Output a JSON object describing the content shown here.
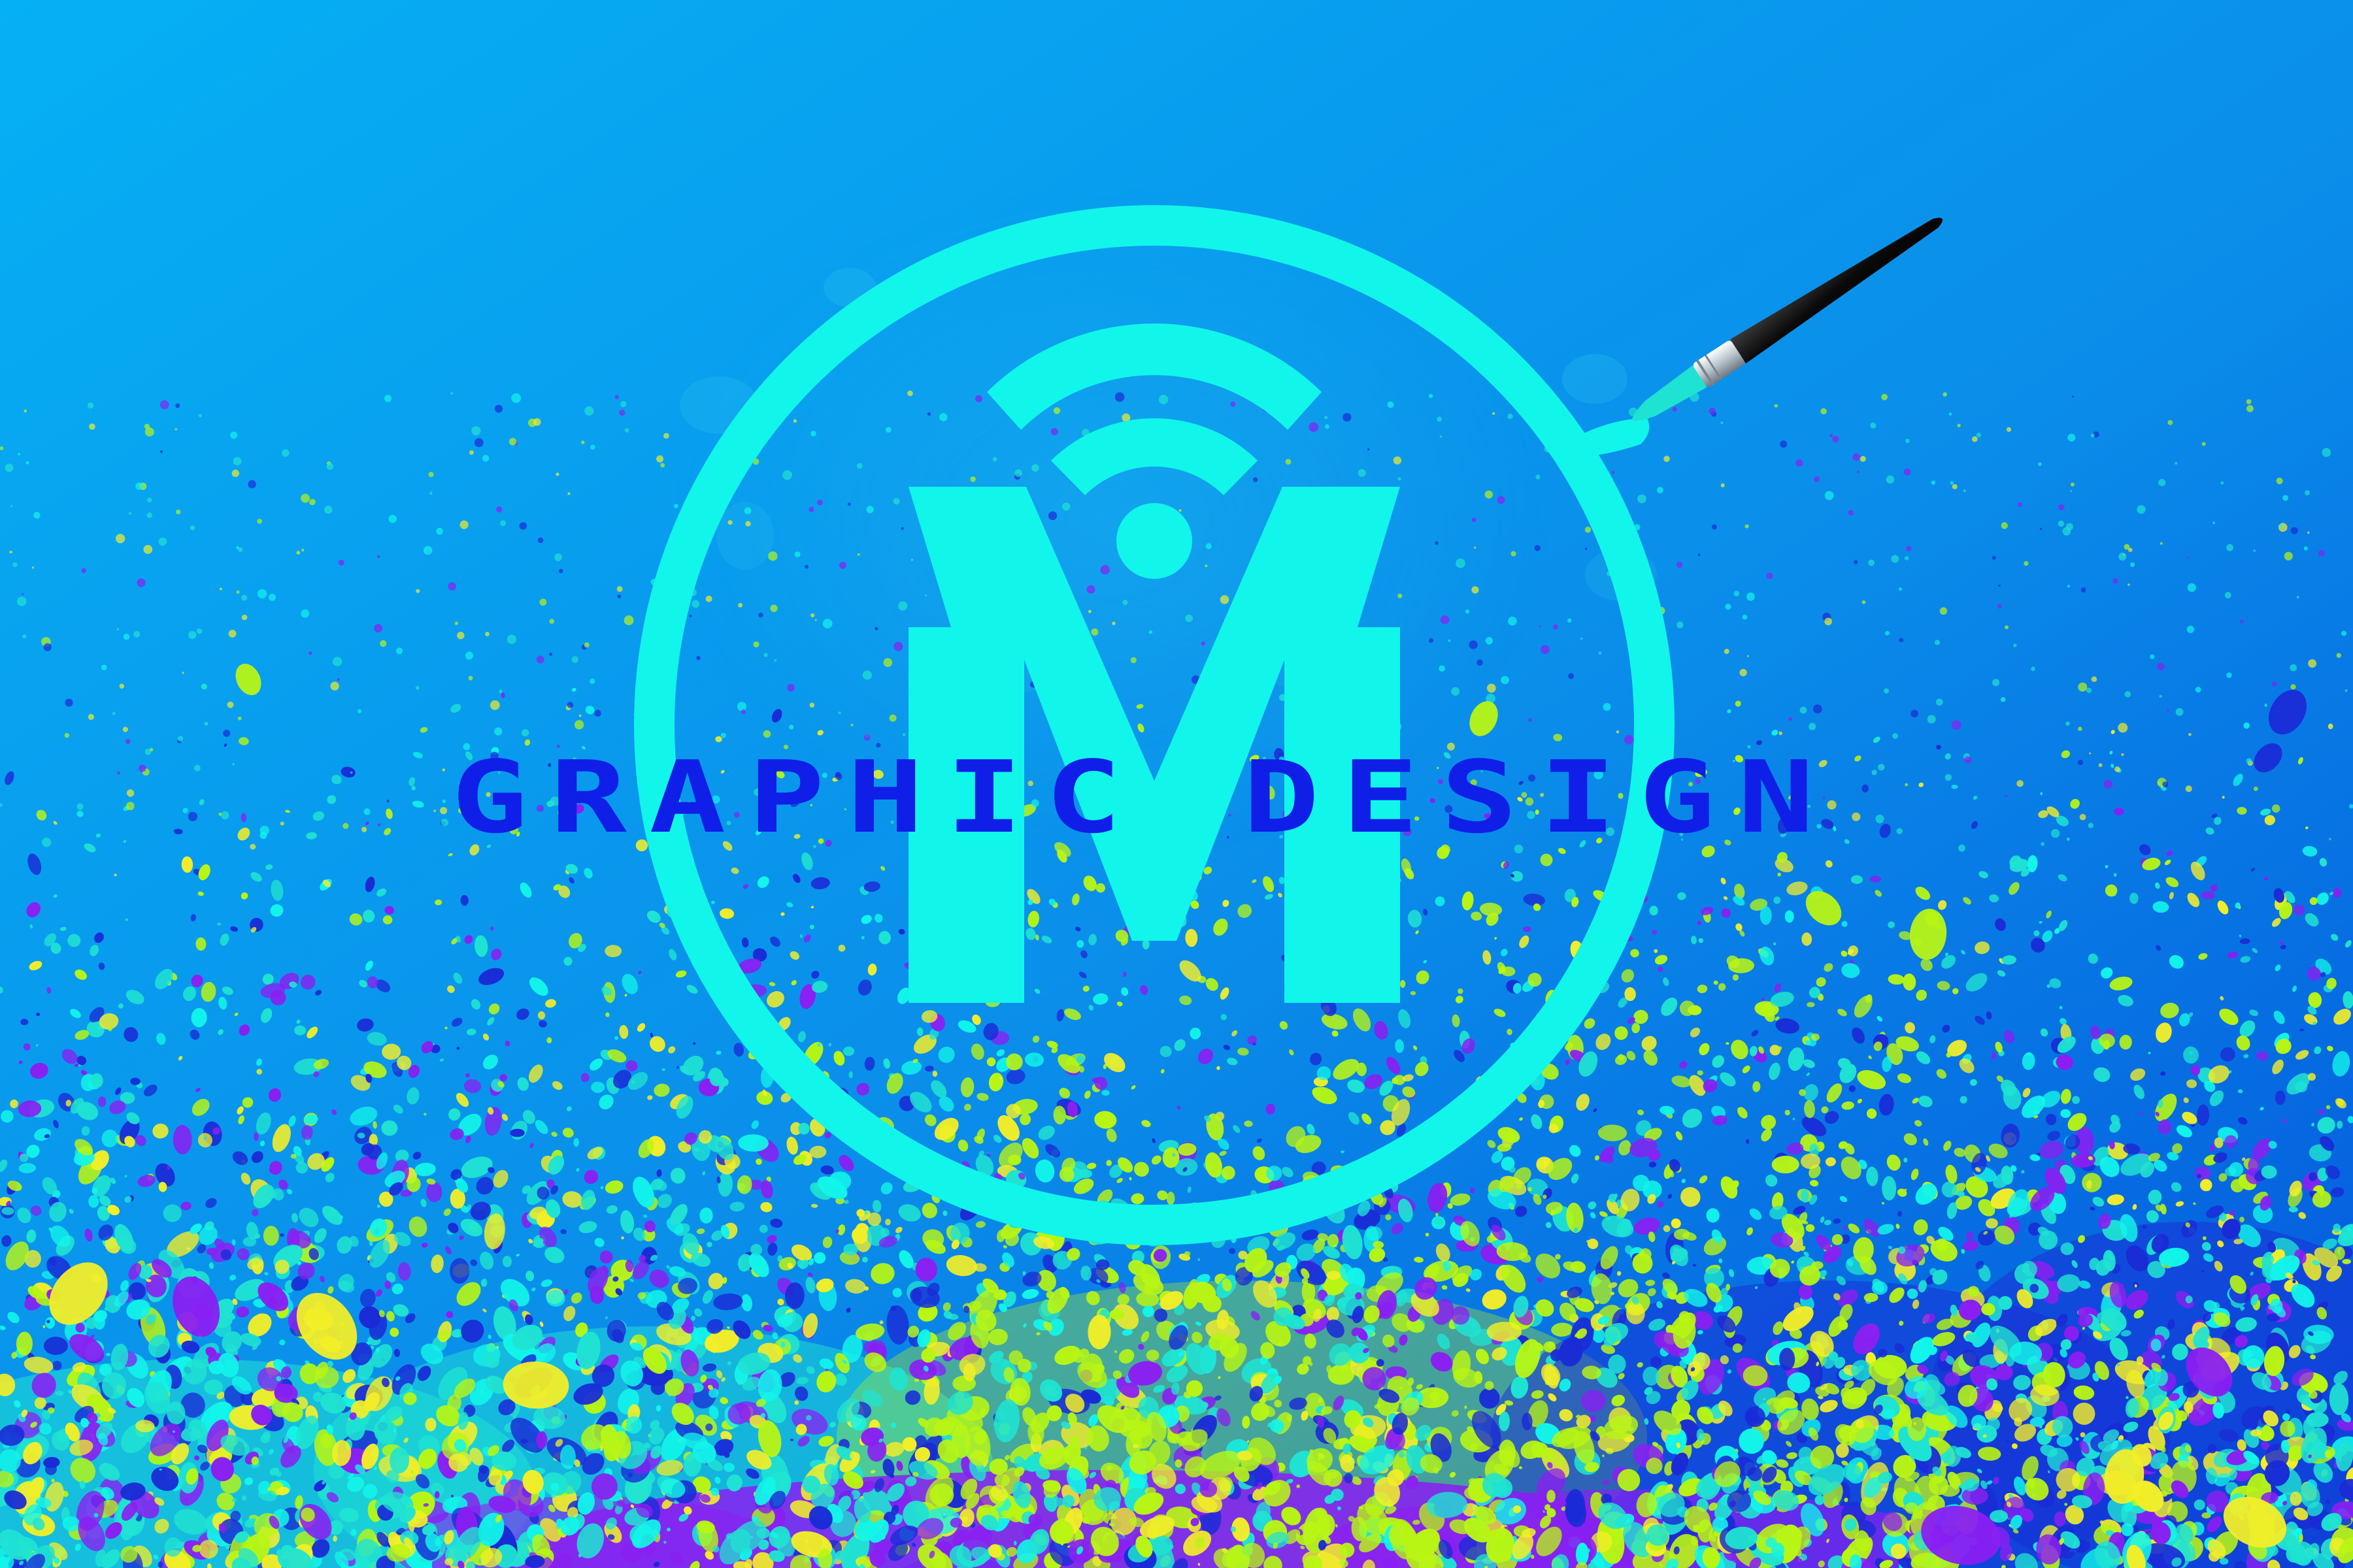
{
  "headline": {
    "text": "GRAPHIC DESIGN"
  },
  "logo": {
    "monogram": "M",
    "icon": "wifi-signal-icon",
    "frame": "circle-ring"
  },
  "brush": {
    "icon": "paintbrush-icon"
  },
  "colors": {
    "bg_top_left": "#06a8f0",
    "bg_bottom_right": "#0560e0",
    "logo_cyan": "#12f5ea",
    "headline_blue": "#0f1fe8",
    "splat_green": "#b8f514",
    "splat_yellow": "#f2ee28",
    "splat_purple": "#8a1ff2",
    "splat_navy": "#1a2bd6",
    "splat_teal": "#1fe3d2"
  }
}
